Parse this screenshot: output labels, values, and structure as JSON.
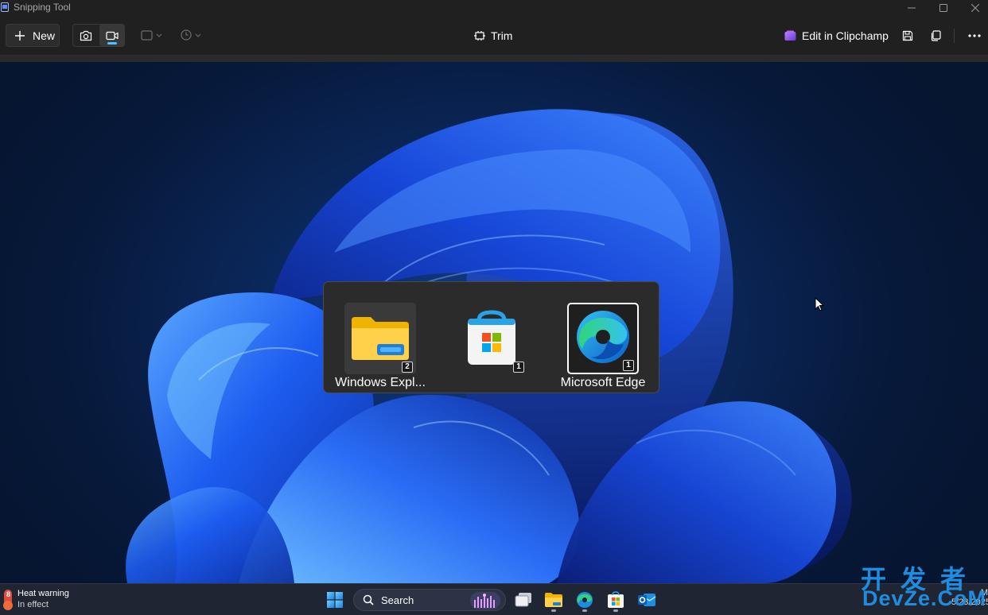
{
  "window": {
    "title": "Snipping Tool",
    "controls": [
      "minimize-icon",
      "maximize-icon",
      "close-icon"
    ]
  },
  "toolbar": {
    "new_label": "New",
    "modes": [
      {
        "icon": "camera-icon",
        "active": false
      },
      {
        "icon": "video-camera-icon",
        "active": true
      }
    ],
    "shape_icon": "rectangle-snip-icon",
    "timer_icon": "timer-icon",
    "trim_label": "Trim",
    "clipchamp_label": "Edit in Clipchamp",
    "right_icons": [
      "save-icon",
      "copy-icon",
      "more-icon"
    ],
    "accent": "#4cc2ff"
  },
  "switcher": {
    "items": [
      {
        "label": "Windows Expl...",
        "badge": "2",
        "icon": "file-explorer-icon",
        "state": "hover"
      },
      {
        "label": "",
        "badge": "1",
        "icon": "microsoft-store-icon",
        "state": "normal"
      },
      {
        "label": "Microsoft Edge",
        "badge": "1",
        "icon": "edge-icon",
        "state": "selected"
      }
    ]
  },
  "taskbar": {
    "weather": {
      "badge": "8",
      "line1": "Heat warning",
      "line2": "In effect"
    },
    "search_placeholder": "Search",
    "clock_time": "M",
    "clock_date": "5/23/2025",
    "apps": [
      "task-view-icon",
      "file-explorer-icon",
      "edge-icon",
      "microsoft-store-icon",
      "outlook-icon"
    ]
  },
  "watermark": {
    "cn": "开发者",
    "en": "DevZe.CoM"
  }
}
